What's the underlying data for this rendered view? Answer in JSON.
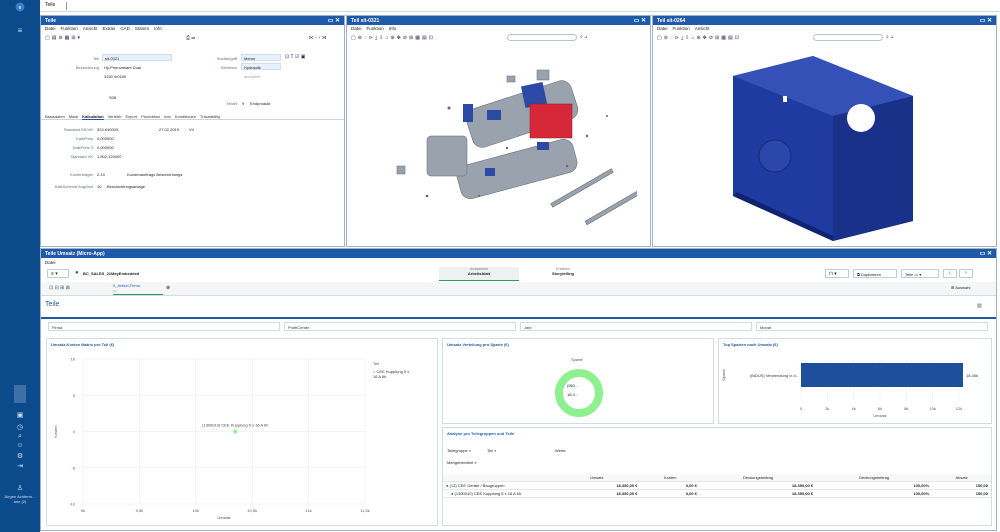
{
  "app": {
    "tab": "Teile"
  },
  "colors": {
    "accent": "#1e5aa8",
    "rail": "#0b4a8b",
    "model": "#233fa8",
    "highlight": "#d62839",
    "donut": "#8ef08e"
  },
  "rail": {
    "icons": [
      "logo-icon",
      "menu-icon",
      "star-icon",
      "screen-icon",
      "clock-icon",
      "search-icon",
      "user-icon",
      "gear-icon",
      "logout-icon",
      "user-avatar-icon"
    ],
    "user_label": "Jürgen Achterm… ann (2)"
  },
  "part_panel": {
    "title": "Teile",
    "menu": [
      "Datei",
      "Funktion",
      "Ansicht",
      "Extras",
      "CAD",
      "Stamm",
      "Info"
    ],
    "fields": {
      "teil_label": "Teil",
      "teil_value": "sit-0321",
      "bez_label": "Bezeichnung",
      "bez_value": "Hy-Pneuvariant Dual",
      "line2": "3150 /h0160",
      "code": "S08",
      "such_label": "Suchbegriff",
      "such_value": "Merne",
      "sel_label": "Selektion",
      "sel_value": "Hydraulik",
      "archiv": "archiviert",
      "teilart_label": "Teilart",
      "teilart_value": "9",
      "teilart_text": "Endprodukt"
    },
    "tabs": [
      "Basisdaten",
      "Mawi",
      "Kalkulation",
      "Vertrieb",
      "Export",
      "Produktion",
      "Info",
      "Konditionen",
      "Traceability"
    ],
    "active_tab": "Kalkulation",
    "calc": [
      {
        "label": "Standard EK/VK",
        "value": "324,640000",
        "date": "27.02.2019",
        "extra": "V4"
      },
      {
        "label": "KalkPreis",
        "value": "0,000000",
        "date": "",
        "extra": ""
      },
      {
        "label": "KalkPreis 2",
        "value": "0,000000",
        "date": "",
        "extra": ""
      },
      {
        "label": "Standard VK",
        "value": "1.802,120000",
        "date": "",
        "extra": ""
      }
    ],
    "kost_label": "Kostenträger",
    "kost_value": "2-10",
    "kost_text": "Kundenauftrags Beschichtungs",
    "schema_label": "KalkSchema Angebot",
    "schema_value": "10",
    "schema_text": "Beschichtungsanlage"
  },
  "view1": {
    "title": "Teil sit-0321",
    "menu": [
      "Datei",
      "Funktion",
      "Info"
    ]
  },
  "view2": {
    "title": "Teil sit-0264",
    "menu": [
      "Datei",
      "Funktion",
      "Ansicht"
    ]
  },
  "analytics": {
    "title": "Teile Umsatz (Micro-App)",
    "menu": "Datei",
    "dataset": "BC_SALES_21MayEmbedded",
    "mode_top": "Analysieren",
    "mode_label": "Arbeitsblatt",
    "mode2_top": "Erzählen",
    "mode2_label": "Storytelling",
    "toolbar": {
      "duplicate": "Duplizieren",
      "teile": "Teile"
    },
    "sheet_tab": "5_Artikel,Firma",
    "sheet_sub": "(1)",
    "page_title": "Teile",
    "auswahl": "Auswahl",
    "filters": [
      "Firma",
      "ProfitCenter",
      "Jahr",
      "Monat"
    ]
  },
  "chart_scatter": {
    "title": "Umsatz-Kosten Matrix pro Teil (€)",
    "legend_title": "Teil",
    "legend_item": "CEE Kupplung 5 x 16 A 6h",
    "point_label": "(1300010) CEE Kupplung 5 x 16 A 6h",
    "xlabel": "Umsatz",
    "ylabel": "Kosten",
    "xticks": [
      "9k",
      "9,5k",
      "10k",
      "10,5k",
      "11k",
      "11,5k"
    ],
    "yticks": [
      "10",
      "5",
      "0",
      "-5",
      "-10"
    ]
  },
  "chart_donut": {
    "title": "Umsatz Verteilung pro Sparte (€)",
    "legend": "Sparte",
    "label1": "(IND...",
    "label2": "18,3..."
  },
  "chart_bar": {
    "title": "Top Sparten nach Umsatz (€)",
    "ylabel": "Sparte",
    "bar_label": "(INDUS) Verwendung in d...",
    "bar_value": "18,35k",
    "xticks": [
      "0",
      "2k",
      "4k",
      "6k",
      "8k",
      "10k",
      "12k"
    ],
    "xlabel": "Umsatz"
  },
  "chart_data": [
    {
      "type": "scatter",
      "title": "Umsatz-Kosten Matrix pro Teil (€)",
      "xlabel": "Umsatz",
      "ylabel": "Kosten",
      "xlim": [
        9000,
        11500
      ],
      "ylim": [
        -10,
        10
      ],
      "series": [
        {
          "name": "CEE Kupplung 5 x 16 A 6h",
          "points": [
            {
              "x": 10350,
              "y": 0
            }
          ]
        }
      ]
    },
    {
      "type": "pie",
      "title": "Umsatz Verteilung pro Sparte (€)",
      "categories": [
        "(IND..."
      ],
      "values": [
        18350
      ]
    },
    {
      "type": "bar",
      "title": "Top Sparten nach Umsatz (€)",
      "categories": [
        "(INDUS) Verwendung in d..."
      ],
      "values": [
        18350
      ],
      "xlim": [
        0,
        12000
      ]
    }
  ],
  "table": {
    "title": "Analyse pro Teilegruppen und Teile",
    "row_fields": [
      "Teilegruppe",
      "Teil"
    ],
    "row_field3": "Mengeneinheit",
    "col_field": "Werte",
    "headers": [
      "Umsatz",
      "Kosten",
      "Deckungsbeitrag",
      "Deckungsbeitrag",
      "Absatz"
    ],
    "rows": [
      {
        "label": "(13) CEE Geräte / Baugruppen",
        "values": [
          "18.350,00 €",
          "0,00 €",
          "18.350,00 €",
          "100,00%",
          "150,00"
        ]
      },
      {
        "label": "(1300010) CEE Kupplung 5 x 16 A 6h",
        "values": [
          "18.350,00 €",
          "0,00 €",
          "18.350,00 €",
          "100,00%",
          "150,00"
        ]
      }
    ]
  }
}
